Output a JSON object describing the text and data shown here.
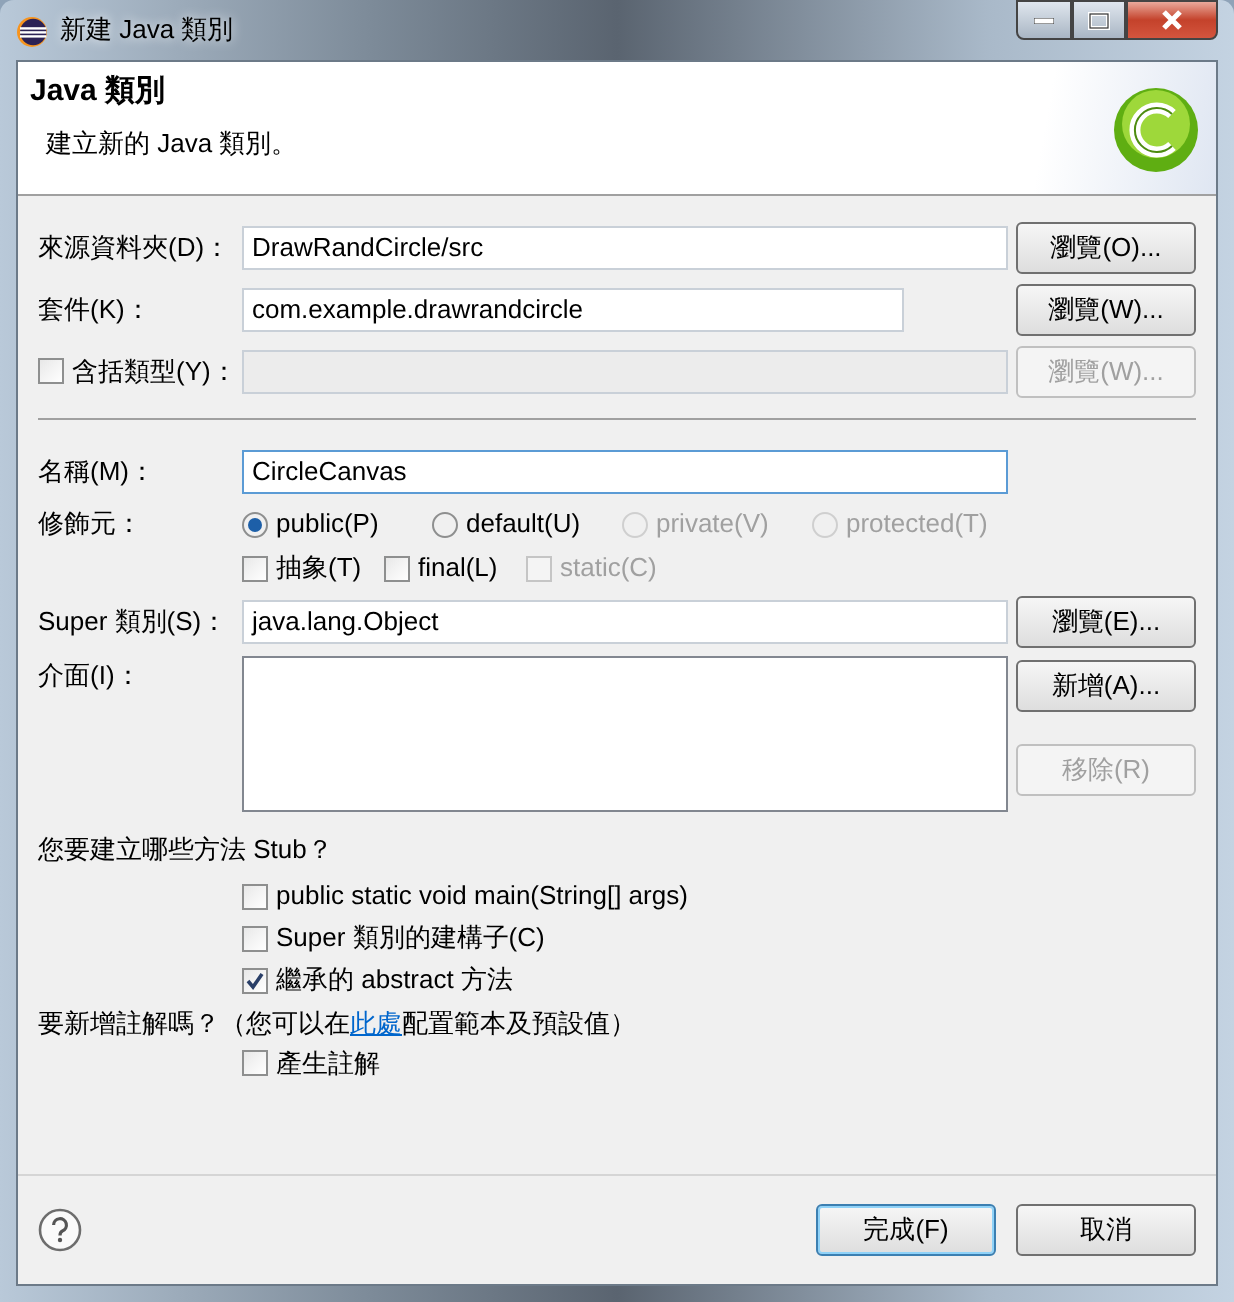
{
  "window": {
    "title": "新建 Java 類別"
  },
  "header": {
    "title": "Java 類別",
    "description": "建立新的 Java 類別。"
  },
  "source_folder": {
    "label": "來源資料夾(D)：",
    "value": "DrawRandCircle/src",
    "browse": {
      "label": "瀏覽(O)...",
      "disabled": false
    }
  },
  "package": {
    "label": "套件(K)：",
    "value": "com.example.drawrandcircle",
    "browse": {
      "label": "瀏覽(W)...",
      "disabled": false
    }
  },
  "enclosing_type": {
    "label": "含括類型(Y)：",
    "checked": false,
    "browse": {
      "label": "瀏覽(W)...",
      "disabled": true
    }
  },
  "name": {
    "label": "名稱(M)：",
    "value": "CircleCanvas",
    "focused": true
  },
  "modifiers": {
    "label": "修飾元：",
    "access": [
      {
        "label": "public(P)",
        "selected": true,
        "disabled": false
      },
      {
        "label": "default(U)",
        "selected": false,
        "disabled": false
      },
      {
        "label": "private(V)",
        "selected": false,
        "disabled": true
      },
      {
        "label": "protected(T)",
        "selected": false,
        "disabled": true
      }
    ],
    "flags": [
      {
        "label": "抽象(T)",
        "checked": false,
        "disabled": false
      },
      {
        "label": "final(L)",
        "checked": false,
        "disabled": false
      },
      {
        "label": "static(C)",
        "checked": false,
        "disabled": true
      }
    ]
  },
  "superclass": {
    "label": "Super 類別(S)：",
    "value": "java.lang.Object",
    "browse": {
      "label": "瀏覽(E)...",
      "disabled": false
    }
  },
  "interfaces": {
    "label": "介面(I)：",
    "add": {
      "label": "新增(A)...",
      "disabled": false
    },
    "remove": {
      "label": "移除(R)",
      "disabled": true
    }
  },
  "stubs": {
    "question": "您要建立哪些方法 Stub？",
    "options": [
      {
        "label": "public static void main(String[] args)",
        "checked": false
      },
      {
        "label": "Super 類別的建構子(C)",
        "checked": false
      },
      {
        "label": "繼承的 abstract 方法",
        "checked": true
      }
    ]
  },
  "comments": {
    "question_before": "要新增註解嗎？（您可以在",
    "link": "此處",
    "question_after": "配置範本及預設值）",
    "options": [
      {
        "label": "產生註解",
        "checked": false
      }
    ]
  },
  "footer": {
    "buttons": [
      {
        "label": "完成(F)",
        "default": true
      },
      {
        "label": "取消",
        "default": false
      }
    ]
  }
}
